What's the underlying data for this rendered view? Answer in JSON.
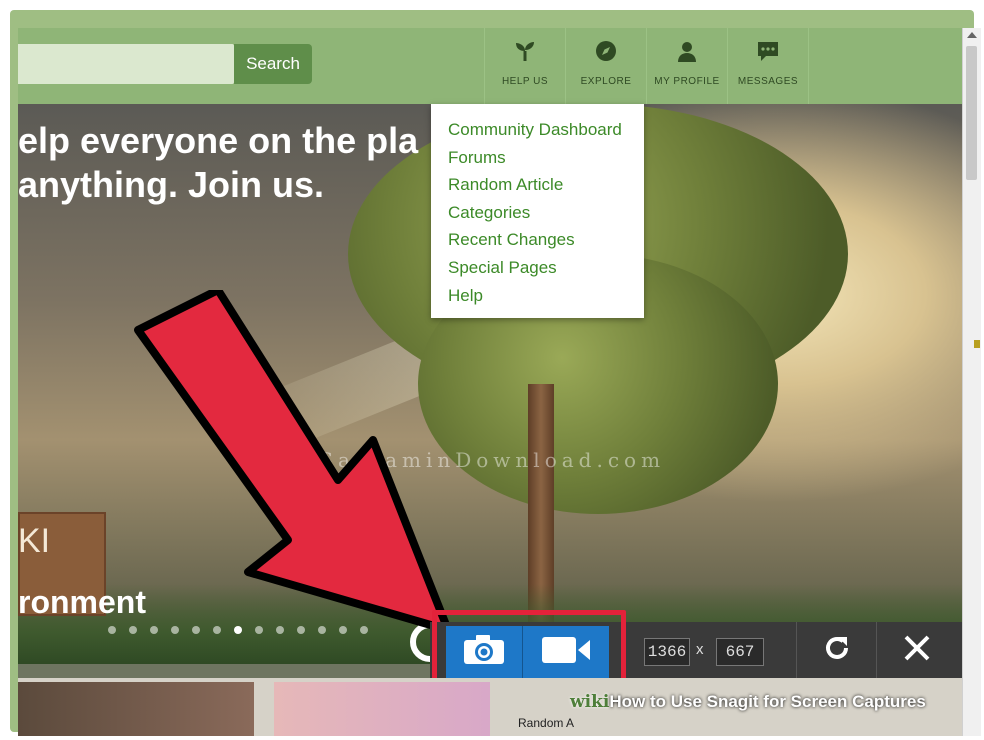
{
  "search": {
    "button_label": "Search",
    "placeholder": ""
  },
  "nav": {
    "items": [
      {
        "label": "HELP US",
        "icon": "sprout-icon"
      },
      {
        "label": "EXPLORE",
        "icon": "compass-icon"
      },
      {
        "label": "MY PROFILE",
        "icon": "user-icon"
      },
      {
        "label": "MESSAGES",
        "icon": "chat-icon"
      }
    ]
  },
  "hero": {
    "line1": "elp everyone on the pla",
    "line2": "anything. Join us.",
    "sign_partial": "KI",
    "caption": "ronment",
    "slide_count": 13,
    "active_slide": 7
  },
  "dropdown": {
    "items": [
      "Community Dashboard",
      "Forums",
      "Random Article",
      "Categories",
      "Recent Changes",
      "Special Pages",
      "Help"
    ]
  },
  "watermark": "www.SarzaminDownload.com",
  "snagit": {
    "width": "1366",
    "separator": "x",
    "height": "667",
    "buttons": [
      "camera-icon",
      "video-icon",
      "redo-icon",
      "close-icon"
    ]
  },
  "bottom": {
    "label": "Random A",
    "banner_wiki": "wiki",
    "banner_text": "How to Use Snagit for Screen Captures"
  },
  "colors": {
    "header_green": "#8fb577",
    "search_button": "#5f8e4a",
    "link_green": "#3c8a28",
    "snagit_blue": "#1e78c8",
    "highlight_red": "#e3223a",
    "arrow_red": "#e3293f"
  }
}
